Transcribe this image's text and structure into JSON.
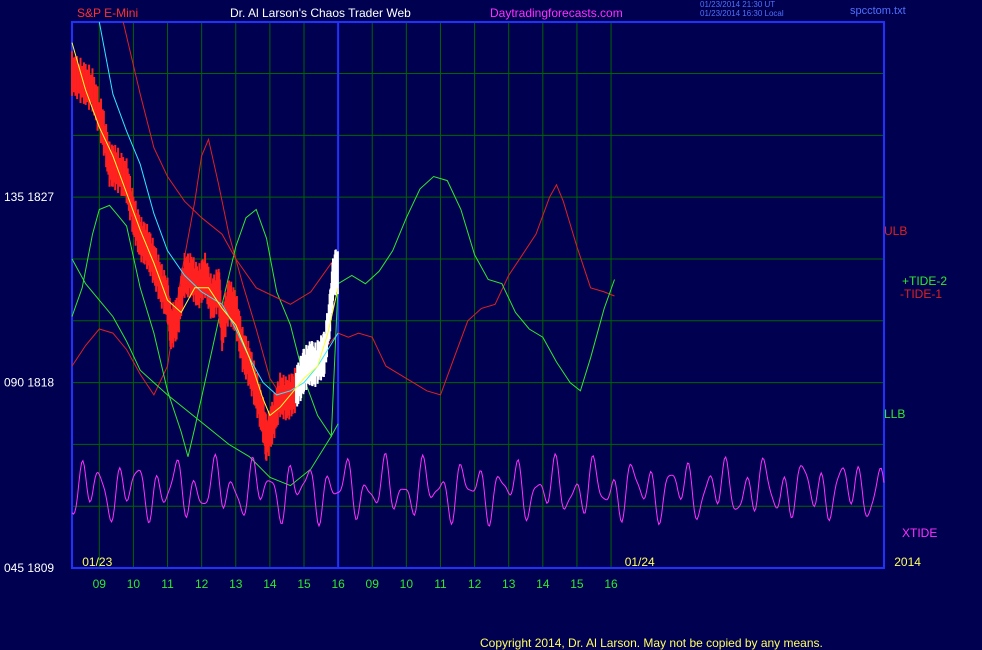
{
  "header": {
    "left": "S&P E-Mini",
    "center": "Dr. Al Larson's Chaos Trader Web",
    "site": "Daytradingforecasts.com",
    "stamp1": "01/23/2014 21:30 UT",
    "stamp2": "01/23/2014 16:30 Local",
    "file": "spcctom.txt"
  },
  "footer": {
    "copyright": "Copyright 2014, Dr. Al Larson. May not be copied by any means."
  },
  "colors": {
    "bg": "#000050",
    "grid": "#006400",
    "axis": "#2030ff",
    "price": "#ff2020",
    "now": "#ffffff",
    "ema_fast": "#ffff30",
    "ema_slow": "#30e8ff",
    "tide_up": "#30e830",
    "tide_down": "#e02020",
    "xtide": "#ff30ff",
    "text_green": "#30e830"
  },
  "chart_data": {
    "type": "line",
    "title": "S&P E-Mini",
    "y_ticks": [
      {
        "value": 1827,
        "label": "135  1827"
      },
      {
        "value": 1818,
        "label": "090  1818"
      },
      {
        "value": 1809,
        "label": "045  1809"
      }
    ],
    "ylim": [
      1809,
      1835.5
    ],
    "x_ticks": [
      "09",
      "10",
      "11",
      "12",
      "13",
      "14",
      "15",
      "16",
      "09",
      "10",
      "11",
      "12",
      "13",
      "14",
      "15",
      "16"
    ],
    "x_range_hours": [
      8.2,
      32.0
    ],
    "date_labels": [
      {
        "text": "01/23",
        "hour": 8.5
      },
      {
        "text": "01/24",
        "hour": 24.4
      },
      {
        "text": "2014",
        "hour": 32.3
      }
    ],
    "now_hour": 16.0,
    "series_labels": [
      {
        "text": "ULB",
        "color": "#e02020"
      },
      {
        "text": "+TIDE-2",
        "color": "#30e830"
      },
      {
        "text": "-TIDE-1",
        "color": "#e02020"
      },
      {
        "text": "LLB",
        "color": "#30e830"
      },
      {
        "text": "XTIDE",
        "color": "#ff30ff"
      }
    ],
    "price_close": [
      [
        8.2,
        1833.0
      ],
      [
        8.5,
        1832.6
      ],
      [
        8.8,
        1832.2
      ],
      [
        9.1,
        1830.4
      ],
      [
        9.3,
        1828.6
      ],
      [
        9.5,
        1828.4
      ],
      [
        9.8,
        1827.8
      ],
      [
        10.0,
        1826.1
      ],
      [
        10.2,
        1825.0
      ],
      [
        10.4,
        1824.6
      ],
      [
        10.6,
        1823.8
      ],
      [
        10.8,
        1822.8
      ],
      [
        11.0,
        1822.0
      ],
      [
        11.1,
        1820.6
      ],
      [
        11.3,
        1821.2
      ],
      [
        11.5,
        1823.2
      ],
      [
        11.7,
        1823.2
      ],
      [
        11.9,
        1822.6
      ],
      [
        12.1,
        1823.2
      ],
      [
        12.3,
        1822.0
      ],
      [
        12.5,
        1822.6
      ],
      [
        12.6,
        1820.6
      ],
      [
        12.8,
        1822.0
      ],
      [
        13.0,
        1821.4
      ],
      [
        13.2,
        1819.6
      ],
      [
        13.4,
        1818.8
      ],
      [
        13.6,
        1817.6
      ],
      [
        13.8,
        1816.2
      ],
      [
        13.9,
        1815.2
      ],
      [
        14.1,
        1816.2
      ],
      [
        14.3,
        1817.4
      ],
      [
        14.5,
        1817.2
      ],
      [
        14.7,
        1817.5
      ],
      [
        14.9,
        1818.2
      ],
      [
        15.0,
        1818.6
      ],
      [
        15.2,
        1819.0
      ],
      [
        15.3,
        1818.8
      ],
      [
        15.5,
        1819.2
      ],
      [
        15.6,
        1819.4
      ],
      [
        15.75,
        1821.2
      ],
      [
        15.85,
        1823.0
      ],
      [
        15.95,
        1823.5
      ],
      [
        16.0,
        1823.3
      ]
    ],
    "ema_fast": [
      [
        8.2,
        1834.5
      ],
      [
        8.6,
        1832.2
      ],
      [
        9.0,
        1830.4
      ],
      [
        9.4,
        1829.0
      ],
      [
        9.8,
        1827.2
      ],
      [
        10.2,
        1825.4
      ],
      [
        10.6,
        1823.8
      ],
      [
        11.0,
        1822.0
      ],
      [
        11.4,
        1821.4
      ],
      [
        11.8,
        1822.6
      ],
      [
        12.2,
        1822.6
      ],
      [
        12.6,
        1821.6
      ],
      [
        13.0,
        1820.8
      ],
      [
        13.4,
        1819.2
      ],
      [
        13.8,
        1817.2
      ],
      [
        14.0,
        1816.4
      ],
      [
        14.3,
        1816.8
      ],
      [
        14.6,
        1817.4
      ],
      [
        15.0,
        1818.2
      ],
      [
        15.4,
        1818.8
      ],
      [
        15.7,
        1820.4
      ],
      [
        16.0,
        1822.6
      ]
    ],
    "ema_slow": [
      [
        9.0,
        1835.5
      ],
      [
        9.4,
        1832.0
      ],
      [
        9.8,
        1830.2
      ],
      [
        10.2,
        1828.6
      ],
      [
        10.6,
        1826.2
      ],
      [
        11.0,
        1824.4
      ],
      [
        11.5,
        1823.2
      ],
      [
        12.0,
        1822.4
      ],
      [
        12.6,
        1821.8
      ],
      [
        13.0,
        1820.6
      ],
      [
        13.4,
        1819.2
      ],
      [
        13.8,
        1818.0
      ],
      [
        14.2,
        1817.4
      ],
      [
        14.6,
        1817.6
      ],
      [
        15.0,
        1818.0
      ],
      [
        15.4,
        1818.8
      ],
      [
        16.0,
        1820.4
      ]
    ],
    "ulb": [
      [
        9.7,
        1835.5
      ],
      [
        10.2,
        1832.0
      ],
      [
        10.6,
        1829.4
      ],
      [
        11.0,
        1828.0
      ],
      [
        11.5,
        1826.8
      ],
      [
        12.0,
        1826.0
      ],
      [
        12.6,
        1825.2
      ],
      [
        13.0,
        1824.0
      ],
      [
        13.6,
        1822.6
      ],
      [
        14.1,
        1822.2
      ],
      [
        14.6,
        1821.8
      ],
      [
        15.2,
        1822.4
      ],
      [
        15.8,
        1823.8
      ],
      [
        16.0,
        1824.2
      ]
    ],
    "llb": [
      [
        8.2,
        1824.0
      ],
      [
        8.6,
        1822.8
      ],
      [
        9.0,
        1822.0
      ],
      [
        9.4,
        1821.2
      ],
      [
        9.8,
        1820.0
      ],
      [
        10.2,
        1818.6
      ],
      [
        10.6,
        1818.0
      ],
      [
        11.0,
        1817.4
      ],
      [
        11.6,
        1816.6
      ],
      [
        12.2,
        1815.8
      ],
      [
        12.8,
        1815.0
      ],
      [
        13.4,
        1814.4
      ],
      [
        14.0,
        1813.4
      ],
      [
        14.6,
        1813.0
      ],
      [
        15.2,
        1813.8
      ],
      [
        15.8,
        1815.4
      ],
      [
        16.0,
        1816.0
      ]
    ],
    "tide_up": [
      [
        8.2,
        1821.2
      ],
      [
        8.5,
        1822.6
      ],
      [
        8.8,
        1825.2
      ],
      [
        9.0,
        1826.4
      ],
      [
        9.3,
        1826.6
      ],
      [
        9.5,
        1826.2
      ],
      [
        9.8,
        1825.6
      ],
      [
        10.2,
        1822.6
      ],
      [
        10.6,
        1820.4
      ],
      [
        11.0,
        1817.6
      ],
      [
        11.4,
        1815.6
      ],
      [
        11.6,
        1814.4
      ],
      [
        11.8,
        1815.8
      ],
      [
        12.2,
        1818.8
      ],
      [
        12.6,
        1821.8
      ],
      [
        13.0,
        1824.6
      ],
      [
        13.3,
        1826.0
      ],
      [
        13.6,
        1826.4
      ],
      [
        13.9,
        1825.0
      ],
      [
        14.2,
        1822.4
      ],
      [
        14.6,
        1820.8
      ],
      [
        15.0,
        1818.2
      ],
      [
        15.4,
        1816.4
      ],
      [
        15.8,
        1815.4
      ],
      [
        16.0,
        1822.8
      ],
      [
        16.4,
        1823.2
      ],
      [
        16.8,
        1822.8
      ],
      [
        17.2,
        1823.4
      ],
      [
        17.6,
        1824.4
      ],
      [
        18.0,
        1826.0
      ],
      [
        18.4,
        1827.4
      ],
      [
        18.8,
        1828.0
      ],
      [
        19.2,
        1827.8
      ],
      [
        19.6,
        1826.4
      ],
      [
        20.0,
        1824.2
      ],
      [
        20.4,
        1823.0
      ],
      [
        20.8,
        1822.8
      ],
      [
        21.2,
        1821.4
      ],
      [
        21.6,
        1820.6
      ],
      [
        22.0,
        1820.2
      ],
      [
        22.4,
        1819.0
      ],
      [
        22.8,
        1818.0
      ],
      [
        23.1,
        1817.6
      ],
      [
        23.4,
        1819.2
      ],
      [
        23.8,
        1821.6
      ],
      [
        24.1,
        1823.0
      ]
    ],
    "tide_down": [
      [
        8.2,
        1818.8
      ],
      [
        8.6,
        1819.8
      ],
      [
        9.0,
        1820.6
      ],
      [
        9.4,
        1820.4
      ],
      [
        9.8,
        1819.6
      ],
      [
        10.2,
        1818.4
      ],
      [
        10.6,
        1817.4
      ],
      [
        11.0,
        1818.8
      ],
      [
        11.4,
        1823.2
      ],
      [
        11.8,
        1826.8
      ],
      [
        12.0,
        1829.0
      ],
      [
        12.2,
        1829.8
      ],
      [
        12.5,
        1827.6
      ],
      [
        12.8,
        1825.2
      ],
      [
        13.2,
        1822.8
      ],
      [
        13.6,
        1820.6
      ],
      [
        14.0,
        1818.2
      ],
      [
        14.4,
        1817.2
      ],
      [
        14.8,
        1817.8
      ],
      [
        15.2,
        1818.6
      ],
      [
        15.6,
        1819.6
      ],
      [
        16.0,
        1820.4
      ],
      [
        16.3,
        1820.2
      ],
      [
        16.6,
        1820.4
      ],
      [
        17.0,
        1820.2
      ],
      [
        17.4,
        1818.8
      ],
      [
        17.8,
        1818.4
      ],
      [
        18.2,
        1818.0
      ],
      [
        18.6,
        1817.6
      ],
      [
        19.0,
        1817.4
      ],
      [
        19.4,
        1819.2
      ],
      [
        19.8,
        1821.0
      ],
      [
        20.2,
        1821.6
      ],
      [
        20.6,
        1821.8
      ],
      [
        21.0,
        1823.2
      ],
      [
        21.4,
        1824.2
      ],
      [
        21.8,
        1825.2
      ],
      [
        22.2,
        1827.0
      ],
      [
        22.4,
        1827.6
      ],
      [
        22.6,
        1826.8
      ],
      [
        23.0,
        1824.6
      ],
      [
        23.4,
        1822.6
      ],
      [
        23.8,
        1822.4
      ],
      [
        24.1,
        1822.2
      ]
    ],
    "xtide": {
      "base": 1812.8,
      "note": "oscillator plotted across full width"
    }
  }
}
